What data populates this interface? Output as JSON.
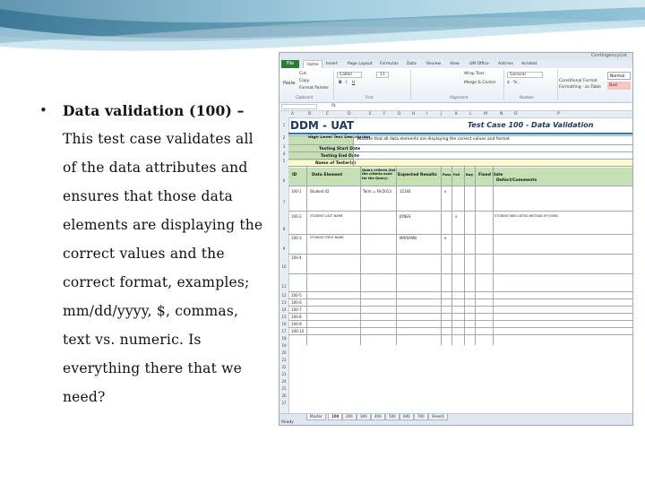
{
  "slide": {
    "bullet_symbol": "•",
    "lines": [
      "Data validation (100) –",
      "This test case validates all",
      "of the data attributes and",
      "ensures that those data",
      "elements are displaying the",
      "correct values and the",
      "correct format, examples;",
      "mm/dd/yyyy, $, commas,",
      "text vs. numeric. Is",
      "everything there that we",
      "need?"
    ]
  },
  "excel": {
    "title_right": "ContingencyList",
    "file_tab": "File",
    "ribbon_tabs": [
      "Home",
      "Insert",
      "Page Layout",
      "Formulas",
      "Data",
      "Review",
      "View",
      "UM Office",
      "Add-Ins",
      "Acrobat"
    ],
    "ribbon": {
      "cut": "Cut",
      "copy": "Copy",
      "paste": "Paste",
      "format_painter": "Format Painter",
      "clipboard": "Clipboard",
      "font_name": "Calibri",
      "font_size": "11",
      "font": "Font",
      "wrap_text": "Wrap Text",
      "merge_center": "Merge & Center",
      "alignment": "Alignment",
      "number_format": "General",
      "number": "Number",
      "conditional": "Conditional Format",
      "formatting": "Formatting · as Table",
      "style_normal": "Normal",
      "style_bad": "Bad"
    },
    "name_box": "",
    "fx": "fx",
    "columns": [
      "A",
      "B",
      "C",
      "D",
      "E",
      "F",
      "G",
      "H",
      "I",
      "J",
      "K",
      "L",
      "M",
      "N",
      "O",
      "P"
    ],
    "row_numbers": [
      "1",
      "2",
      "3",
      "4",
      "5",
      "6",
      "7",
      "8",
      "9",
      "10",
      "11",
      "12",
      "13",
      "14",
      "15",
      "16",
      "17",
      "18",
      "19",
      "20",
      "21",
      "22",
      "23",
      "24",
      "25",
      "26",
      "27",
      "28",
      "29",
      "30"
    ],
    "sheet_title": "DDM - UAT",
    "test_case_title": "Test Case 100 - Data Validation",
    "meta_labels": [
      "High Level Test Description",
      "Testing Start Date",
      "Testing End Date",
      "Name of Tester(s)"
    ],
    "meta_value": "Validate that all data elements are displaying the correct values and format",
    "table_headers": [
      "ID",
      "Data Element",
      "Query criteria (list the criteria used for the Query)",
      "Expected Results",
      "Pass",
      "Fail",
      "Bug",
      "Fixed Date",
      "Defect/Comments"
    ],
    "rows": [
      {
        "id": "100-1",
        "element": "Student ID",
        "criteria": "Term = FA/2013",
        "expected": "12344",
        "mark": "x",
        "comment": ""
      },
      {
        "id": "100-2",
        "element": "STUDENT LAST NAME",
        "criteria": "",
        "expected": "JONES",
        "mark": "x",
        "comment": "STUDENT WAS LISTED INSTEAD OF JONES"
      },
      {
        "id": "100-3",
        "element": "STUDENT FIRST NAME",
        "criteria": "",
        "expected": "MARIANN",
        "mark": "x",
        "comment": ""
      },
      {
        "id": "100-4",
        "element": "",
        "criteria": "",
        "expected": "",
        "mark": "",
        "comment": ""
      },
      {
        "id": "100-5",
        "element": "",
        "criteria": "",
        "expected": "",
        "mark": "",
        "comment": ""
      },
      {
        "id": "100-6",
        "element": "",
        "criteria": "",
        "expected": "",
        "mark": "",
        "comment": ""
      },
      {
        "id": "100-7",
        "element": "",
        "criteria": "",
        "expected": "",
        "mark": "",
        "comment": ""
      },
      {
        "id": "100-8",
        "element": "",
        "criteria": "",
        "expected": "",
        "mark": "",
        "comment": ""
      },
      {
        "id": "100-9",
        "element": "",
        "criteria": "",
        "expected": "",
        "mark": "",
        "comment": ""
      },
      {
        "id": "100-10",
        "element": "",
        "criteria": "",
        "expected": "",
        "mark": "",
        "comment": ""
      }
    ],
    "sheet_tabs": [
      "Master",
      "100",
      "200",
      "300",
      "400",
      "500",
      "600",
      "700",
      "Sheet1"
    ],
    "active_sheet_index": 1,
    "status": "Ready",
    "colors": {
      "file_tab": "#2f7a3a",
      "title_blue": "#1f3864",
      "header_green": "#c6e0b4",
      "highlight_yellow": "#fff9c4"
    }
  }
}
